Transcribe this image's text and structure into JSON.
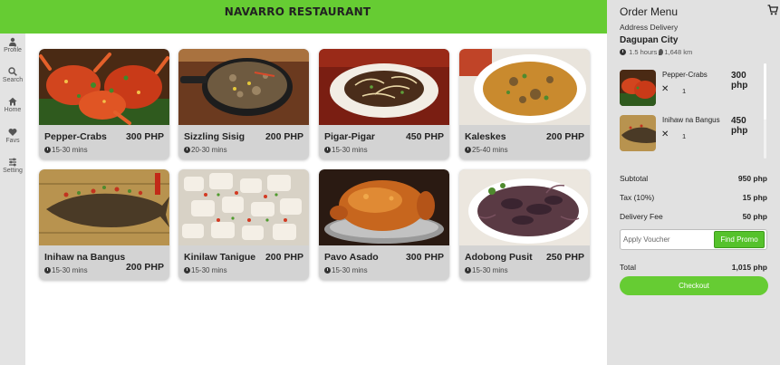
{
  "header": {
    "title": "NAVARRO RESTAURANT",
    "color": "#66cc33"
  },
  "sidebar": {
    "items": [
      {
        "label": "Profile",
        "icon": "user-icon"
      },
      {
        "label": "Search",
        "icon": "search-icon"
      },
      {
        "label": "Home",
        "icon": "home-icon"
      },
      {
        "label": "Favs",
        "icon": "heart-icon"
      },
      {
        "label": "Setting",
        "icon": "sliders-icon"
      }
    ]
  },
  "menu": {
    "items": [
      {
        "name": "Pepper-Crabs",
        "price": "300 PHP",
        "time": "15-30 mins"
      },
      {
        "name": "Sizzling Sisig",
        "price": "200 PHP",
        "time": "20-30 mins"
      },
      {
        "name": "Pigar-Pigar",
        "price": "450 PHP",
        "time": "15-30 mins"
      },
      {
        "name": "Kaleskes",
        "price": "200 PHP",
        "time": "25-40 mins"
      },
      {
        "name": "Inihaw na Bangus",
        "price": "200 PHP",
        "time": "15-30 mins"
      },
      {
        "name": "Kinilaw Tanigue",
        "price": "200 PHP",
        "time": "15-30 mins"
      },
      {
        "name": "Pavo Asado",
        "price": "300 PHP",
        "time": "15-30 mins"
      },
      {
        "name": "Adobong Pusit",
        "price": "250 PHP",
        "time": "15-30 mins"
      }
    ]
  },
  "order": {
    "title": "Order Menu",
    "address_label": "Address Delivery",
    "city": "Dagupan City",
    "eta": "1.5 hours",
    "distance": "1,648 km",
    "items": [
      {
        "name": "Pepper-Crabs",
        "qty_symbol": "✕",
        "qty": "1",
        "price": "300 php"
      },
      {
        "name": "Inihaw na Bangus",
        "qty_symbol": "✕",
        "qty": "1",
        "price": "450 php"
      }
    ],
    "summary": {
      "subtotal_label": "Subtotal",
      "subtotal": "950 php",
      "tax_label": "Tax (10%)",
      "tax": "15 php",
      "delivery_label": "Delivery Fee",
      "delivery": "50 php",
      "total_label": "Total",
      "total": "1,015 php"
    },
    "voucher_placeholder": "Apply Voucher",
    "promo_button": "Find Promo",
    "checkout_button": "Checkout"
  },
  "colors": {
    "accent": "#66cc33",
    "panel": "#e1e1e1",
    "card": "#d3d3d3",
    "sidebar": "#e3e3e3"
  }
}
